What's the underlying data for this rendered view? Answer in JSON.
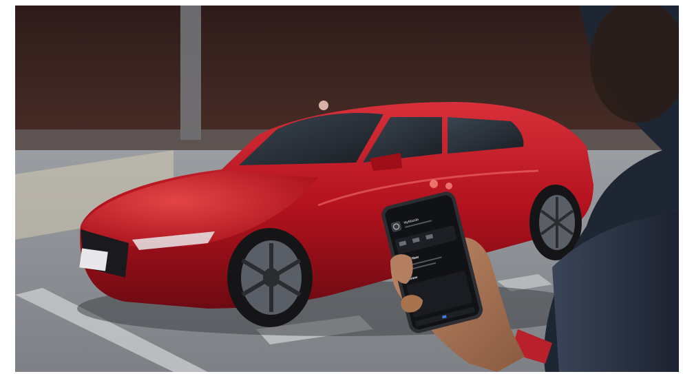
{
  "photo": {
    "subject": "red hatchback car with smartphone app in hand",
    "colors": {
      "car": "#b0101c",
      "car_highlight": "#e23a3a",
      "wall": "#3e2622",
      "ground": "#8d9095",
      "phone_screen": "#111216",
      "skin": "#a8785a",
      "sleeve": "#2a3446"
    }
  },
  "phone_app": {
    "title": "MyMazda",
    "section_whats_new": "What's New",
    "section_preview": "Preview"
  }
}
